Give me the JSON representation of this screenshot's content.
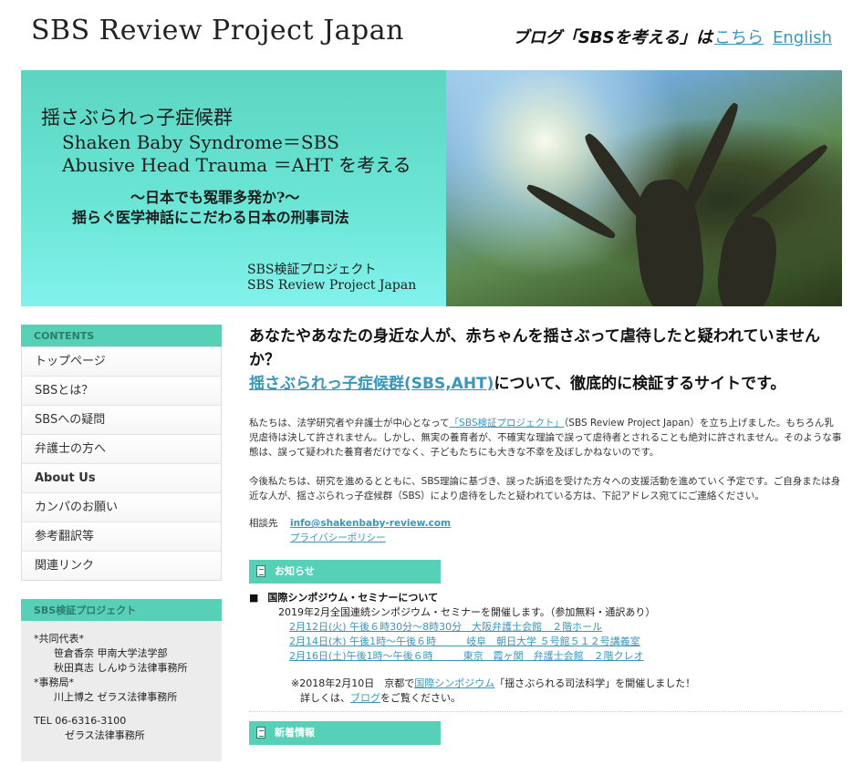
{
  "header": {
    "site_title": "SBS Review Project Japan",
    "blog_prefix": "ブログ「SBSを考える」は",
    "blog_link": "こちら",
    "english_link": "English"
  },
  "hero": {
    "line1": "揺さぶられっ子症候群",
    "line2": "Shaken Baby Syndrome＝SBS",
    "line3": "Abusive Head Trauma ＝AHT を考える",
    "line4": "〜日本でも冤罪多発か?〜",
    "line5": "揺らぐ医学神話にこだわる日本の刑事司法",
    "line6": "SBS検証プロジェクト",
    "line7": "SBS Review Project Japan"
  },
  "sidebar": {
    "contents_title": "CONTENTS",
    "items": [
      {
        "label": "トップページ"
      },
      {
        "label": "SBSとは？"
      },
      {
        "label": "SBSへの疑問"
      },
      {
        "label": "弁護士の方へ"
      },
      {
        "label": "About Us"
      },
      {
        "label": "カンパのお願い"
      },
      {
        "label": "参考翻訳等"
      },
      {
        "label": "関連リンク"
      }
    ],
    "project_title": "SBS検証プロジェクト",
    "project_lines": [
      "*共同代表*",
      "笹倉香奈 甲南大学法学部",
      "秋田真志 しんゆう法律事務所",
      "*事務局*",
      "川上博之 ゼラス法律事務所",
      "TEL 06-6316-3100",
      "ゼラス法律事務所"
    ]
  },
  "main": {
    "lead1": "あなたやあなたの身近な人が、赤ちゃんを揺さぶって虐待したと疑われていませんか？",
    "lead_link": "揺さぶられっ子症候群(SBS,AHT)",
    "lead2": "について、徹底的に検証するサイトです。",
    "p1_a": "私たちは、法学研究者や弁護士が中心となって",
    "p1_link": "「SBS検証プロジェクト」",
    "p1_b": "（SBS Review Project Japan）を立ち上げました。もちろん乳児虐待は決して許されません。しかし、無実の養育者が、不確実な理論で誤って虐待者とされることも絶対に許されません。そのような事態は、誤って疑われた養育者だけでなく、子どもたちにも大きな不幸を及ぼしかねないのです。",
    "p2": "今後私たちは、研究を進めるとともに、SBS理論に基づき、誤った訴追を受けた方々への支援活動を進めていく予定です。ご自身または身近な人が、揺さぶられっ子症候群（SBS）により虐待をしたと疑われている方は、下記アドレス宛てにご連絡ください。",
    "contact_label": "相談先",
    "email": "info@shakenbaby-review.com",
    "privacy": "プライバシーポリシー",
    "news_title": "お知らせ",
    "news_item_title": "国際シンポジウム・セミナーについて",
    "news_item_body": "2019年2月全国連続シンポジウム・セミナーを開催します。（参加無料・通訳あり）",
    "events": [
      "2月12日(火) 午後６時30分〜8時30分　大阪弁護士会館　２階ホール",
      "2月14日(木) 午後1時〜午後６時　　　岐阜　朝日大学 ５号館５１２号講義室",
      "2月16日(土)午後1時〜午後６時　　　東京　霞ヶ関　弁護士会館　２階クレオ"
    ],
    "note_a": "※2018年2月10日　京都で",
    "note_link": "国際シンポジウム",
    "note_b": "「揺さぶられる司法科学」を開催しました！",
    "note2_a": "詳しくは、",
    "note2_link": "ブログ",
    "note2_b": "をご覧ください。",
    "latest_title": "新着情報"
  }
}
